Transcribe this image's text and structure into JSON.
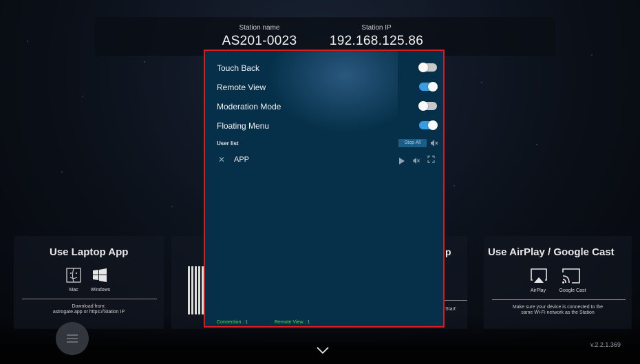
{
  "station": {
    "name_label": "Station name",
    "name_value": "AS201-0023",
    "ip_label": "Station IP",
    "ip_value": "192.168.125.86"
  },
  "laptop_card": {
    "title": "Use Laptop App",
    "mac_label": "Mac",
    "windows_label": "Windows",
    "download_line1": "Download from:",
    "download_line2": "astrogate.app  or  https://Station IP"
  },
  "middle_card": {
    "partial_text": "Start'",
    "partial_title_fragment": "p"
  },
  "cast_card": {
    "title": "Use AirPlay / Google Cast",
    "airplay_label": "AirPlay",
    "googlecast_label": "Google Cast",
    "note_line1": "Make sure your device is connected to the",
    "note_line2": "same Wi-Fi network as the Station"
  },
  "settings": {
    "toggles": [
      {
        "label": "Touch Back",
        "on": false
      },
      {
        "label": "Remote View",
        "on": true
      },
      {
        "label": "Moderation Mode",
        "on": false
      },
      {
        "label": "Floating Menu",
        "on": true
      }
    ],
    "user_list_label": "User list",
    "stop_all_label": "Stop All",
    "users": [
      {
        "name": "APP"
      }
    ],
    "connection_text": "Connection : 1",
    "remote_view_text": "Remote View : 1"
  },
  "version": "v.2.2.1.369",
  "colors": {
    "panel_bg": "#063049",
    "panel_border": "#d91c1c",
    "toggle_on": "#3a9de0",
    "status_green": "#45e04a"
  }
}
